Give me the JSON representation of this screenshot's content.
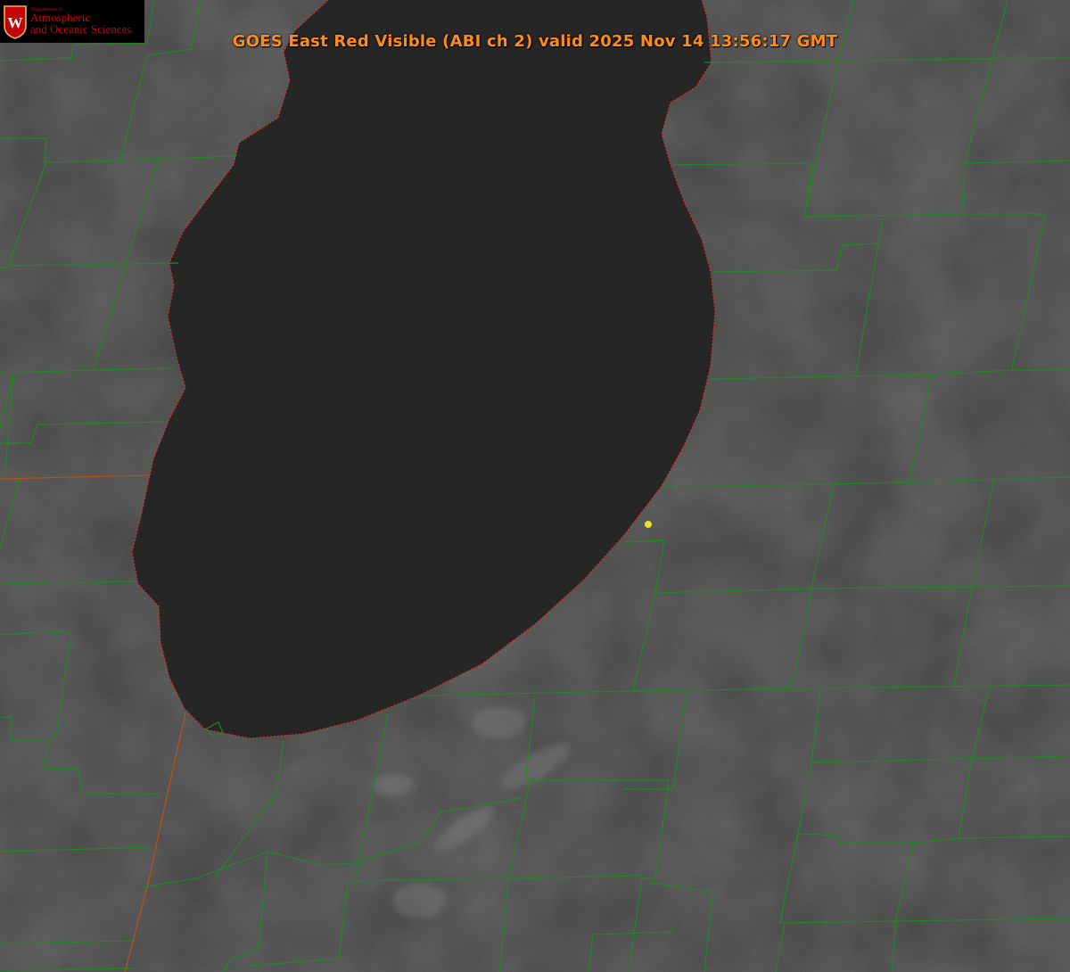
{
  "header": {
    "title": "GOES East Red Visible (ABI ch 2) valid 2025 Nov 14 13:56:17 GMT"
  },
  "logo": {
    "department": "Department of",
    "line1": "Atmospheric",
    "line2": "and Oceanic Sciences",
    "crest_letter": "W"
  },
  "map": {
    "land_color": "#3a3a3a",
    "lake_color": "#262626",
    "county_border_color": "#1f8a1f",
    "state_border_color": "#b8530f",
    "shoreline_color": "#e02828",
    "marker_color": "#e8e030",
    "marker_icon": "location-dot-icon"
  }
}
